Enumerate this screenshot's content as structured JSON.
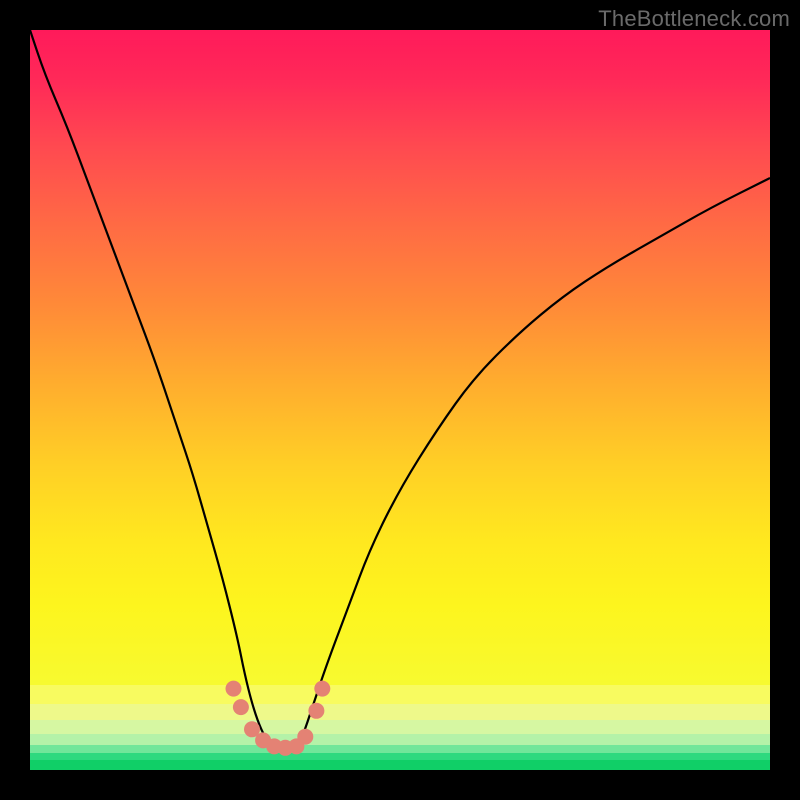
{
  "watermark": "TheBottleneck.com",
  "chart_data": {
    "type": "line",
    "title": "",
    "xlabel": "",
    "ylabel": "",
    "xlim": [
      0,
      100
    ],
    "ylim": [
      0,
      100
    ],
    "series": [
      {
        "name": "bottleneck-curve",
        "x": [
          0,
          2,
          5,
          8,
          11,
          14,
          17,
          20,
          22,
          24,
          26,
          28,
          29,
          30,
          31,
          32,
          33,
          34,
          35,
          36,
          37,
          38,
          40,
          43,
          46,
          50,
          55,
          60,
          66,
          72,
          78,
          85,
          92,
          100
        ],
        "y": [
          100,
          94,
          87,
          79,
          71,
          63,
          55,
          46,
          40,
          33,
          26,
          18,
          13,
          9,
          6,
          4,
          3,
          2.5,
          2.5,
          3,
          5,
          8,
          14,
          22,
          30,
          38,
          46,
          53,
          59,
          64,
          68,
          72,
          76,
          80
        ]
      },
      {
        "name": "dot-cluster",
        "x": [
          27.5,
          28.5,
          30,
          31.5,
          33,
          34.5,
          36,
          37.2,
          38.7,
          39.5
        ],
        "y": [
          11,
          8.5,
          5.5,
          4,
          3.2,
          3,
          3.2,
          4.5,
          8,
          11
        ]
      }
    ],
    "bands": [
      {
        "color": "#f8fb60",
        "top_pct": 88.5,
        "height_pct": 2.6
      },
      {
        "color": "#eef98a",
        "top_pct": 91.1,
        "height_pct": 2.1
      },
      {
        "color": "#d6f7a2",
        "top_pct": 93.2,
        "height_pct": 1.9
      },
      {
        "color": "#b4f2a8",
        "top_pct": 95.1,
        "height_pct": 1.5
      },
      {
        "color": "#71e69a",
        "top_pct": 96.6,
        "height_pct": 1.1
      },
      {
        "color": "#2ed97f",
        "top_pct": 97.7,
        "height_pct": 0.9
      },
      {
        "color": "#10cf67",
        "top_pct": 98.6,
        "height_pct": 1.4
      }
    ],
    "curve_color": "#000000",
    "dot_color": "#e48274",
    "dot_radius": 8
  }
}
